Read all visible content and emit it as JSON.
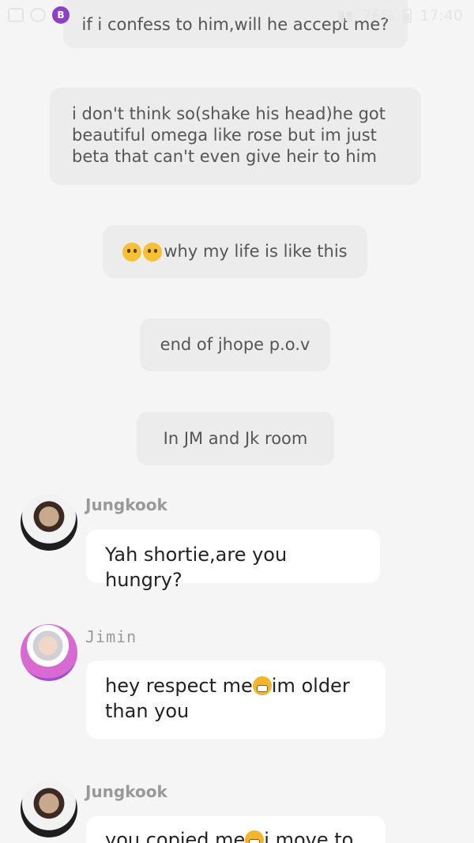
{
  "status_bar": {
    "battery_percent": "76%",
    "time": "17:40",
    "app_badge": "B"
  },
  "narration": [
    {
      "text": "if i confess to him,will he accept me?"
    },
    {
      "text": "i don't think so(shake his head)he got beautiful omega like rose but im just beta that can't even give heir to him"
    },
    {
      "text_after_emoji": "why my life is like this",
      "emojis": [
        "crying-face",
        "crying-face"
      ]
    },
    {
      "text": "end of jhope p.o.v"
    },
    {
      "text": "In JM and Jk room"
    }
  ],
  "messages": [
    {
      "sender": "Jungkook",
      "text": "Yah shortie,are you hungry?"
    },
    {
      "sender": "Jimin",
      "text_before": "hey respect me",
      "emoji": "huffing-face",
      "text_after": "im older than you"
    },
    {
      "sender": "Jungkook",
      "text_before": "you copied me",
      "emoji": "huffing-face",
      "text_after": "i move to"
    }
  ]
}
